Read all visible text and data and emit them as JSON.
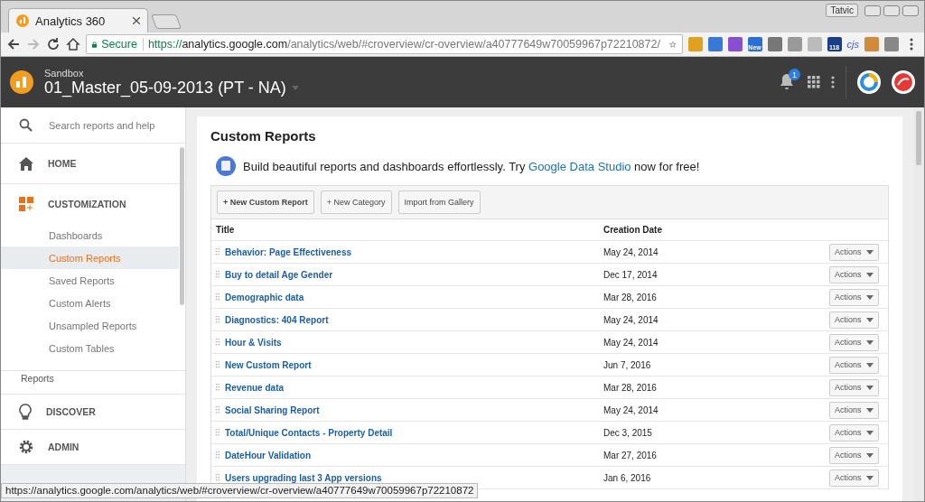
{
  "browser": {
    "tab_title": "Analytics 360",
    "profile": "Tatvic",
    "secure_label": "Secure",
    "url_scheme": "https://",
    "url_host": "analytics.google.com",
    "url_path": "/analytics/web/#croverview/cr-overview/a40777649w70059967p72210872/",
    "extensions": [
      {
        "kind": "icon",
        "color": "#e0a020"
      },
      {
        "kind": "icon",
        "color": "#3a78d8"
      },
      {
        "kind": "icon",
        "color": "#8a4fd0"
      },
      {
        "kind": "badge",
        "label": "New",
        "color": "#2a6fd6"
      },
      {
        "kind": "icon",
        "color": "#777777"
      },
      {
        "kind": "icon",
        "color": "#999999"
      },
      {
        "kind": "icon",
        "color": "#bbbbbb"
      },
      {
        "kind": "badge",
        "label": "118",
        "color": "#1a3d8a"
      },
      {
        "kind": "text",
        "label": "cjs",
        "color": "#3a5bd0"
      },
      {
        "kind": "icon",
        "color": "#d08a3a"
      },
      {
        "kind": "icon",
        "color": "#888888"
      }
    ]
  },
  "header": {
    "account": "Sandbox",
    "view": "01_Master_05-09-2013 (PT - NA)",
    "notifications": "1"
  },
  "sidebar": {
    "search_placeholder": "Search reports and help",
    "sections": [
      {
        "label": "HOME",
        "expanded": false
      },
      {
        "label": "CUSTOMIZATION",
        "expanded": true,
        "children": [
          {
            "label": "Dashboards",
            "selected": false
          },
          {
            "label": "Custom Reports",
            "selected": true
          },
          {
            "label": "Saved Reports",
            "selected": false
          },
          {
            "label": "Custom Alerts",
            "selected": false
          },
          {
            "label": "Unsampled Reports",
            "selected": false
          },
          {
            "label": "Custom Tables",
            "selected": false
          }
        ]
      }
    ],
    "reports_heading": "Reports",
    "bottom_items": [
      {
        "label": "DISCOVER"
      },
      {
        "label": "ADMIN"
      }
    ]
  },
  "page": {
    "title": "Custom Reports",
    "promo_before": "Build beautiful reports and dashboards effortlessly. Try ",
    "promo_link": "Google Data Studio",
    "promo_after": " now for free!",
    "buttons": [
      {
        "label": "+ New Custom Report",
        "primary": true
      },
      {
        "label": "+ New Category",
        "primary": false
      },
      {
        "label": "Import from Gallery",
        "primary": false
      }
    ],
    "table": {
      "columns": [
        "Title",
        "Creation Date"
      ],
      "rows": [
        {
          "title": "Behavior: Page Effectiveness",
          "date": "May 24, 2014",
          "action": "Actions"
        },
        {
          "title": "Buy to detail Age Gender",
          "date": "Dec 17, 2014",
          "action": "Actions"
        },
        {
          "title": "Demographic data",
          "date": "Mar 28, 2016",
          "action": "Actions"
        },
        {
          "title": "Diagnostics: 404 Report",
          "date": "May 24, 2014",
          "action": "Actions"
        },
        {
          "title": "Hour & Visits",
          "date": "May 24, 2014",
          "action": "Actions"
        },
        {
          "title": "New Custom Report",
          "date": "Jun 7, 2016",
          "action": "Actions"
        },
        {
          "title": "Revenue data",
          "date": "Mar 28, 2016",
          "action": "Actions"
        },
        {
          "title": "Social Sharing Report",
          "date": "May 24, 2014",
          "action": "Actions"
        },
        {
          "title": "Total/Unique Contacts - Property Detail",
          "date": "Dec 3, 2015",
          "action": "Actions"
        },
        {
          "title": "DateHour Validation",
          "date": "Mar 27, 2016",
          "action": "Actions"
        },
        {
          "title": "Users upgrading last 3 App versions",
          "date": "Jan 6, 2016",
          "action": "Actions"
        }
      ]
    }
  },
  "status_bar": "https://analytics.google.com/analytics/web/#croverview/cr-overview/a40777649w70059967p72210872"
}
